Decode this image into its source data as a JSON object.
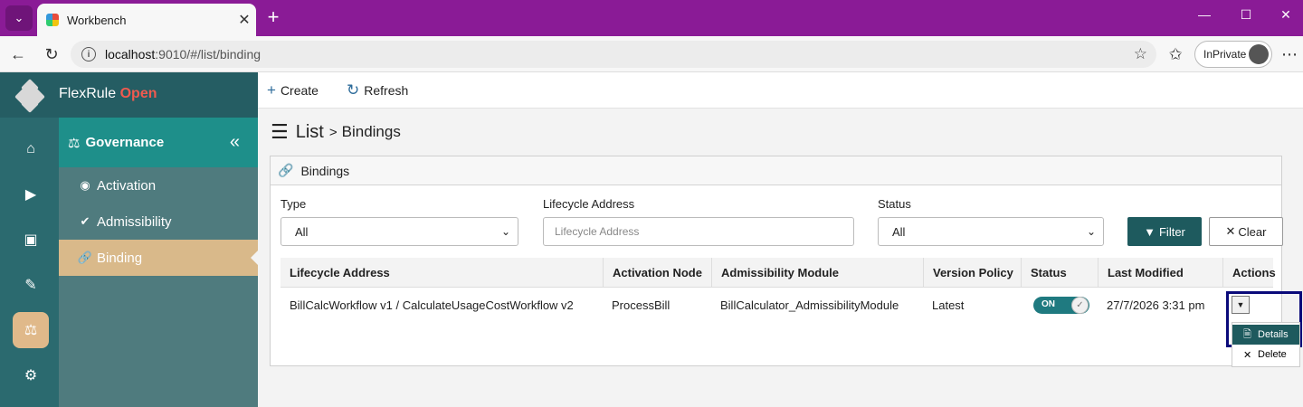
{
  "browser": {
    "tab_title": "Workbench",
    "url_host": "localhost",
    "url_path": ":9010/#/list/binding",
    "inprivate_label": "InPrivate"
  },
  "app": {
    "brand_name": "FlexRule",
    "brand_accent": "Open",
    "rail_icons": [
      "home-icon",
      "play-icon",
      "archive-icon",
      "pencil-icon",
      "scales-icon",
      "gear-icon"
    ],
    "submenu": {
      "title": "Governance",
      "items": [
        {
          "label": "Activation",
          "icon": "toggle-icon"
        },
        {
          "label": "Admissibility",
          "icon": "check-circle-icon"
        },
        {
          "label": "Binding",
          "icon": "link-icon"
        }
      ]
    }
  },
  "toolbar": {
    "create_label": "Create",
    "refresh_label": "Refresh"
  },
  "breadcrumb": {
    "root": "List",
    "separator": ">",
    "current": "Bindings"
  },
  "panel": {
    "title": "Bindings"
  },
  "filters": {
    "type_label": "Type",
    "type_value": "All",
    "lifecycle_label": "Lifecycle Address",
    "lifecycle_placeholder": "Lifecycle Address",
    "status_label": "Status",
    "status_value": "All",
    "filter_button": "Filter",
    "clear_button": "Clear"
  },
  "table": {
    "columns": [
      "Lifecycle Address",
      "Activation Node",
      "Admissibility Module",
      "Version Policy",
      "Status",
      "Last Modified",
      "Actions"
    ],
    "rows": [
      {
        "lifecycle_address": "BillCalcWorkflow v1 / CalculateUsageCostWorkflow v2",
        "activation_node": "ProcessBill",
        "admissibility_module": "BillCalculator_AdmissibilityModule",
        "version_policy": "Latest",
        "status": "ON",
        "last_modified": "27/7/2026 3:31 pm"
      }
    ]
  },
  "actions_menu": {
    "details": "Details",
    "delete": "Delete"
  },
  "colors": {
    "browser_purple": "#8a1b96",
    "teal_dark": "#1e5a5e",
    "accent_tan": "#d9b98a",
    "brand_red": "#f05a4f"
  }
}
